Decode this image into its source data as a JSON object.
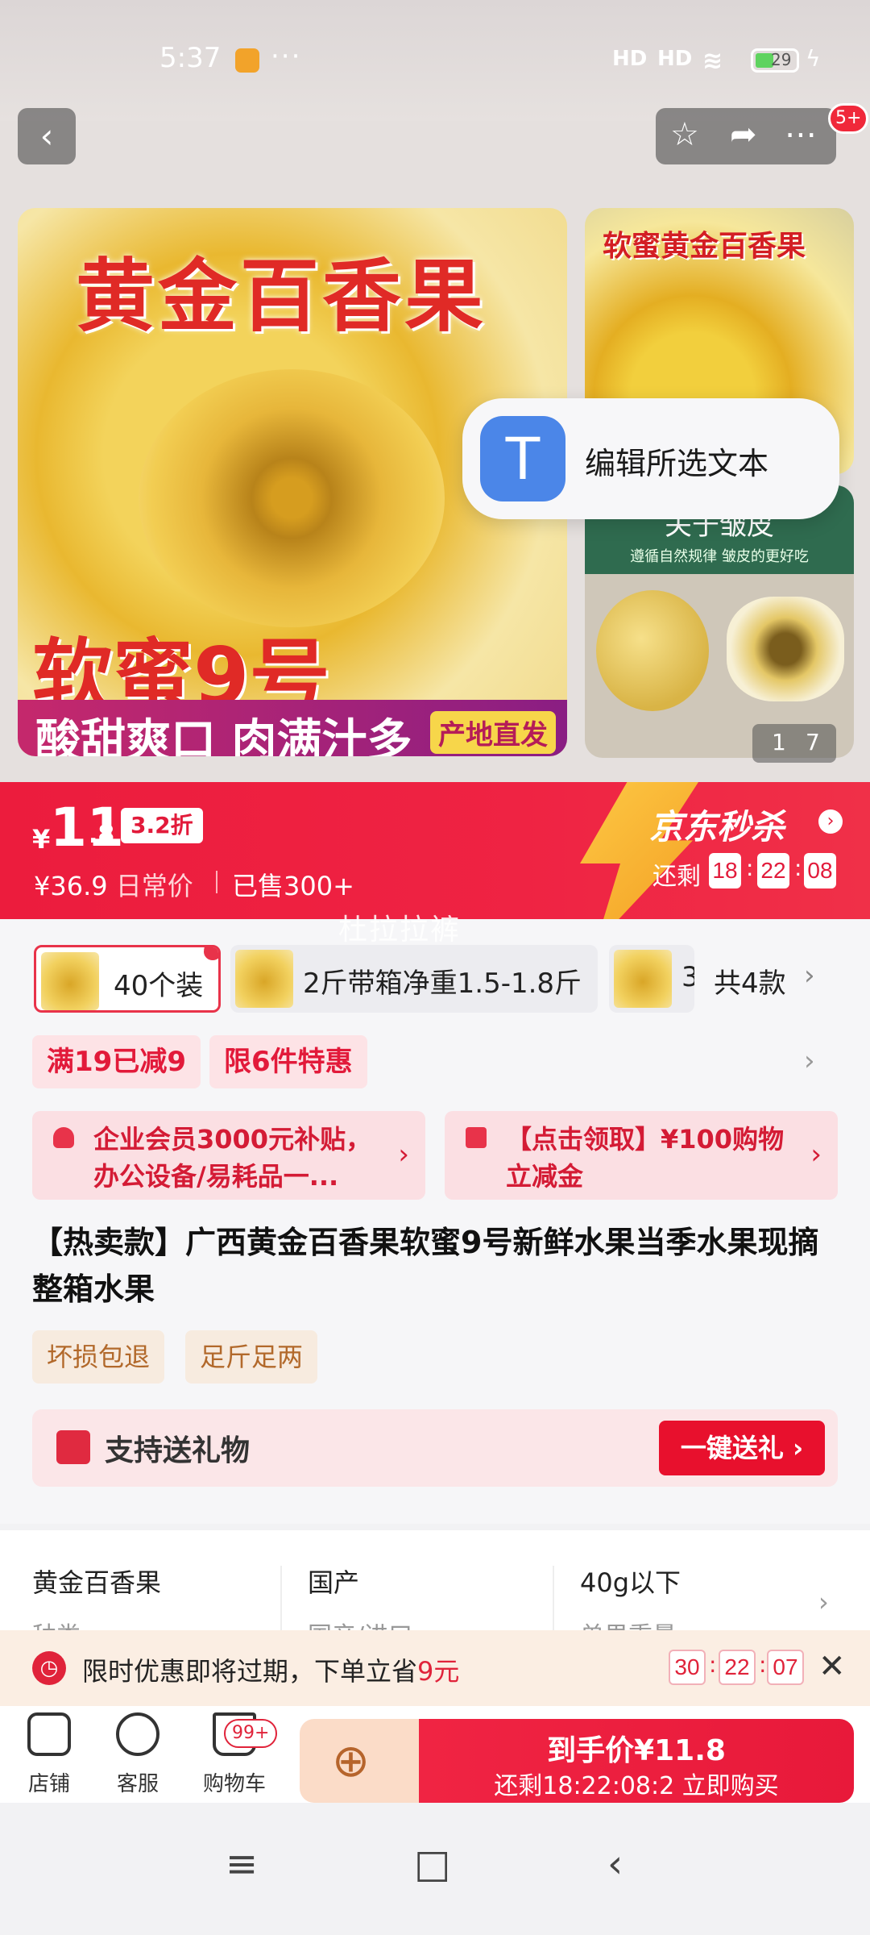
{
  "status": {
    "time": "5:37",
    "dots": "···",
    "signal1": "HD",
    "signal2": "HD",
    "battery": "29"
  },
  "nav": {
    "back": "‹",
    "badge": "5+"
  },
  "gallery": {
    "main_title": "黄金百香果",
    "main_variety": "软蜜9号",
    "main_slogan": "酸甜爽口 肉满汁多",
    "main_tag": "产地直发",
    "side1_title": "软蜜黄金百香果",
    "side2_title": "关于皱皮",
    "side2_sub": "遵循自然规律 皱皮的更好吃",
    "counter_current": "1",
    "counter_total": "7"
  },
  "popup": {
    "icon": "T",
    "text": "编辑所选文本"
  },
  "price": {
    "yen": "¥",
    "integer": "11",
    "decimal": ".8",
    "discount": "3.2折",
    "original_prefix": "¥36.9",
    "original_label": "日常价",
    "sold": "已售300+",
    "brand": "京东秒杀",
    "remain_label": "还剩",
    "hh": "18",
    "mm": "22",
    "ss": "08"
  },
  "watermark": "杜拉拉裤",
  "variants": [
    {
      "label": "40个装"
    },
    {
      "label": "2斤带箱净重1.5-1.8斤"
    },
    {
      "label": "3"
    }
  ],
  "variants_total": "共4款",
  "promos": [
    "满19已减9",
    "限6件特惠"
  ],
  "coupons": [
    {
      "text": "企业会员3000元补贴，办公设备/易耗品一..."
    },
    {
      "text": "【点击领取】¥100购物立减金"
    }
  ],
  "title": "【热卖款】广西黄金百香果软蜜9号新鲜水果当季水果现摘整箱水果",
  "services": [
    "坏损包退",
    "足斤足两"
  ],
  "gift": {
    "text": "支持送礼物",
    "button": "一键送礼 ›"
  },
  "attrs": [
    {
      "value": "黄金百香果",
      "label": "种类"
    },
    {
      "value": "国产",
      "label": "国产/进口"
    },
    {
      "value": "40g以下",
      "label": "单果重量"
    }
  ],
  "notice": {
    "text": "限时优惠即将过期，下单立省",
    "amount": "9元",
    "hh": "30",
    "mm": "22",
    "ss": "07"
  },
  "bottom": {
    "store": "店铺",
    "service": "客服",
    "cart": "购物车",
    "cart_badge": "99+",
    "buy_line1": "到手价¥11.8",
    "buy_line2": "还剩18:22:08:2 立即购买"
  },
  "colors": {
    "accent": "#e8193a",
    "banner": "#ef2343"
  }
}
